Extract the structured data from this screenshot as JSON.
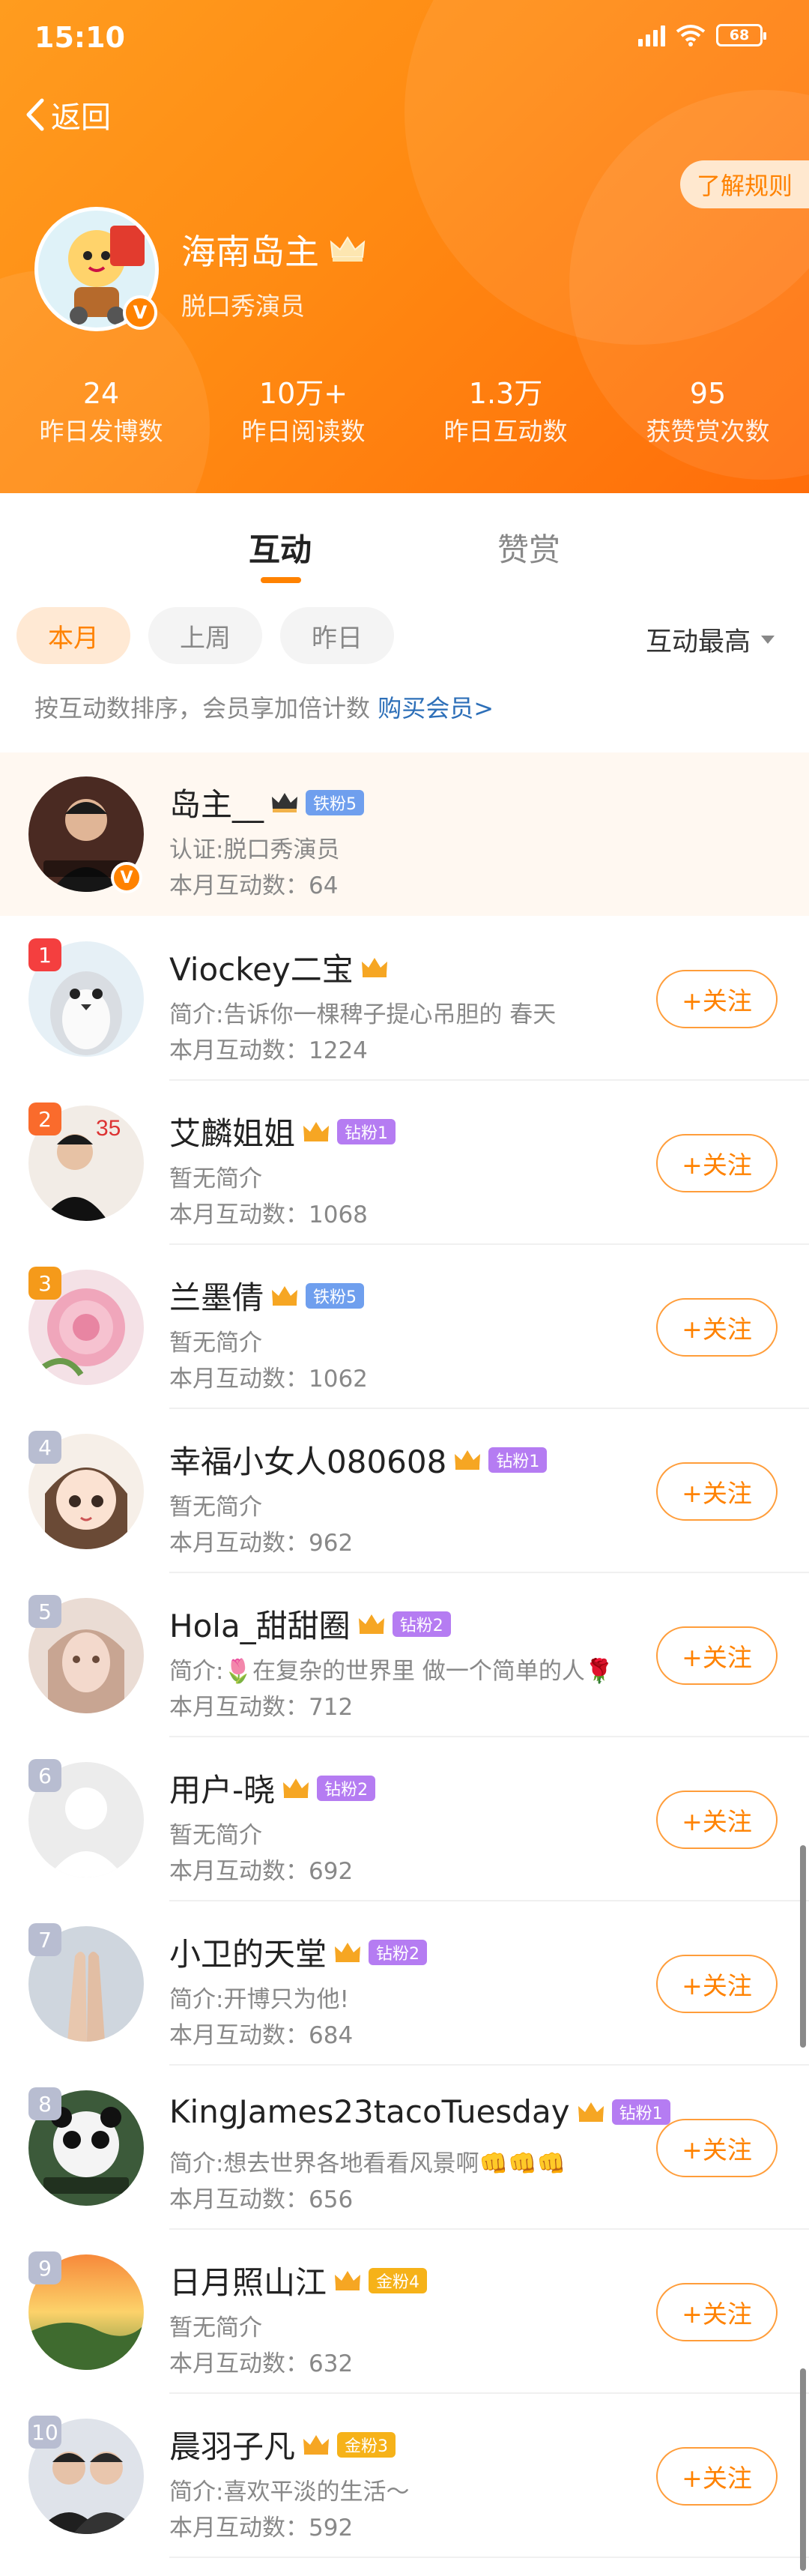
{
  "status_bar": {
    "time": "15:10",
    "battery": "68"
  },
  "header": {
    "back_label": "返回",
    "rule_button": "了解规则",
    "owner_name": "海南岛主",
    "owner_title": "脱口秀演员",
    "stats": [
      {
        "value": "24",
        "label": "昨日发博数"
      },
      {
        "value": "10万+",
        "label": "昨日阅读数"
      },
      {
        "value": "1.3万",
        "label": "昨日互动数"
      },
      {
        "value": "95",
        "label": "获赞赏次数"
      }
    ]
  },
  "tabs": [
    {
      "label": "互动",
      "active": true
    },
    {
      "label": "赞赏",
      "active": false
    }
  ],
  "filters": {
    "chips": [
      "本月",
      "上周",
      "昨日"
    ],
    "sort_label": "互动最高"
  },
  "hint": {
    "text": "按互动数排序，会员享加倍计数 ",
    "link": "购买会员>"
  },
  "colors": {
    "accent": "#ff8200",
    "link": "#2d6fb8"
  },
  "follow_label": "+关注",
  "self_row": {
    "name": "岛主__",
    "fan_badge": "铁粉5",
    "desc": "认证:脱口秀演员",
    "count": "本月互动数：64"
  },
  "list": [
    {
      "rank": "1",
      "name": "Viockey二宝",
      "badge": "",
      "desc": "简介:告诉你一棵稗子提心吊胆的 春天",
      "count": "本月互动数：1224"
    },
    {
      "rank": "2",
      "name": "艾麟姐姐",
      "badge": "钻粉1",
      "desc": "暂无简介",
      "count": "本月互动数：1068"
    },
    {
      "rank": "3",
      "name": "兰墨倩",
      "badge": "铁粉5",
      "desc": "暂无简介",
      "count": "本月互动数：1062"
    },
    {
      "rank": "4",
      "name": "幸福小女人080608",
      "badge": "钻粉1",
      "desc": "暂无简介",
      "count": "本月互动数：962"
    },
    {
      "rank": "5",
      "name": "Hola_甜甜圈",
      "badge": "钻粉2",
      "desc": "简介:🌷在复杂的世界里 做一个简单的人🌹",
      "count": "本月互动数：712"
    },
    {
      "rank": "6",
      "name": "用户-晓",
      "badge": "钻粉2",
      "desc": "暂无简介",
      "count": "本月互动数：692"
    },
    {
      "rank": "7",
      "name": "小卫的天堂",
      "badge": "钻粉2",
      "desc": "简介:开博只为他!",
      "count": "本月互动数：684"
    },
    {
      "rank": "8",
      "name": "KingJames23tacoTuesday",
      "badge": "钻粉1",
      "desc": "简介:想去世界各地看看风景啊👊👊👊",
      "count": "本月互动数：656"
    },
    {
      "rank": "9",
      "name": "日月照山江",
      "badge": "金粉4",
      "desc": "暂无简介",
      "count": "本月互动数：632"
    },
    {
      "rank": "10",
      "name": "晨羽子凡",
      "badge": "金粉3",
      "desc": "简介:喜欢平淡的生活～",
      "count": "本月互动数：592"
    }
  ]
}
